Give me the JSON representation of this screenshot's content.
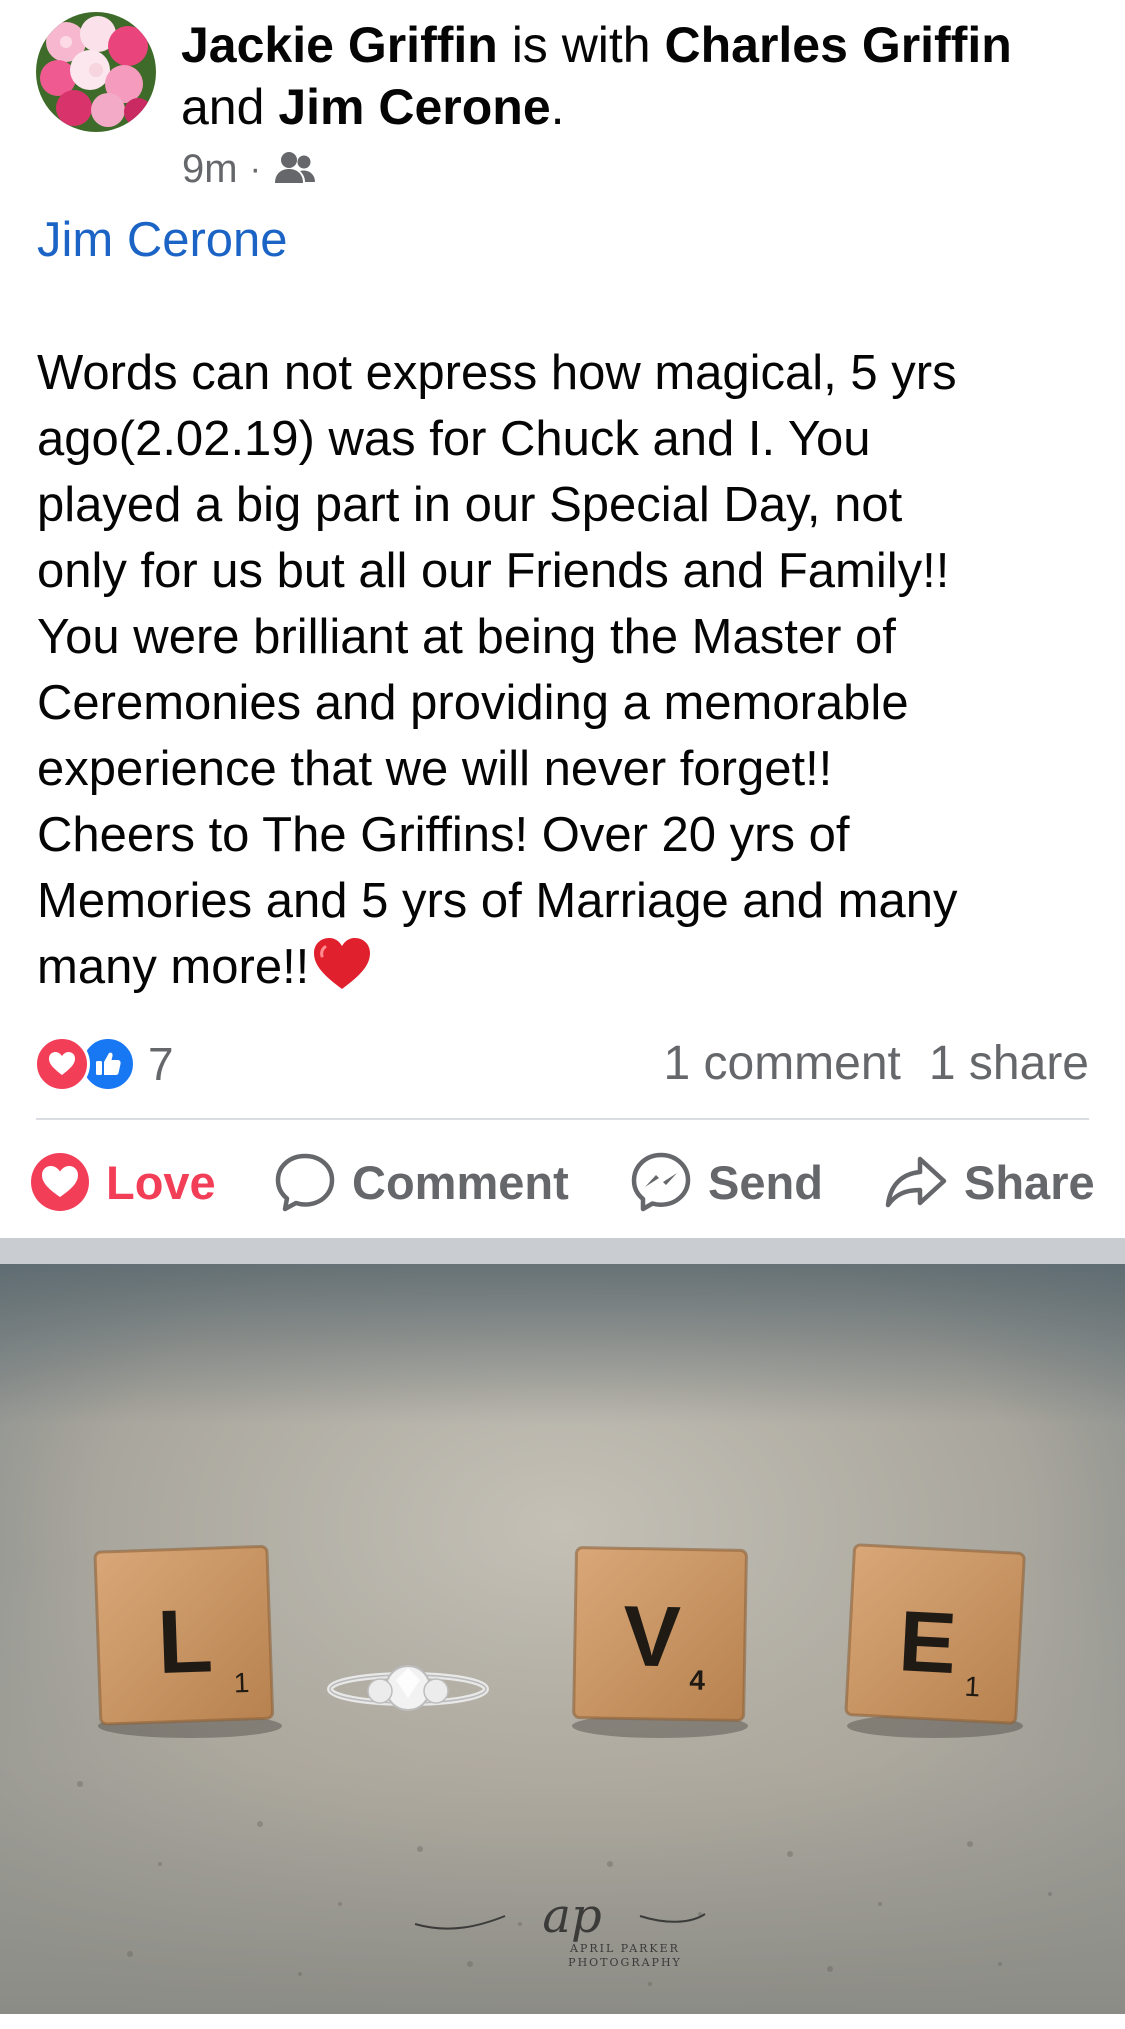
{
  "post": {
    "author": "Jackie Griffin",
    "with_text": " is with ",
    "friend1": "Charles Griffin",
    "and_text": "and ",
    "friend2": "Jim Cerone",
    "period": ".",
    "time": "9m",
    "separator_dot": "·",
    "audience_icon": "friends-icon",
    "tagged_name": "Jim Cerone",
    "body": "Words can not express how magical, 5 yrs\nago(2.02.19) was for Chuck and I.  You\nplayed a big part in our Special Day, not\nonly for us but all our Friends and Family!!\nYou were brilliant at being the Master of\nCeremonies and providing a memorable\nexperience that we will never forget!!\nCheers to The Griffins!  Over 20 yrs of\nMemories and 5 yrs of Marriage and many\nmany more!!"
  },
  "stats": {
    "reaction_count": "7",
    "comments": "1 comment",
    "shares": "1 share"
  },
  "actions": {
    "love": "Love",
    "comment": "Comment",
    "send": "Send",
    "share": "Share"
  },
  "photo": {
    "tiles": [
      {
        "letter": "L",
        "points": "1"
      },
      {
        "letter": "V",
        "points": "4"
      },
      {
        "letter": "E",
        "points": "1"
      }
    ],
    "watermark_script": "ap",
    "watermark_text": "APRIL PARKER",
    "watermark_sub": "PHOTOGRAPHY"
  },
  "colors": {
    "link_blue": "#1b64c6",
    "love_red": "#f33e58",
    "like_blue": "#1877f2",
    "secondary_text": "#65676b"
  }
}
